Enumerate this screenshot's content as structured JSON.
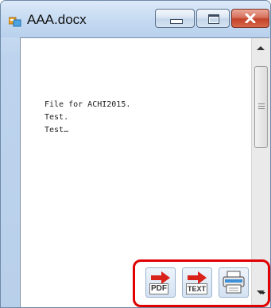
{
  "window": {
    "title": "AAA.docx",
    "title_icon": "app-window-icon",
    "controls": {
      "minimize": "minimize-icon",
      "maximize": "maximize-icon",
      "close": "close-icon"
    }
  },
  "document": {
    "lines": [
      "File for ACHI2015.",
      "Test.",
      "Test…"
    ]
  },
  "toolbar": {
    "highlight_color": "#e00000",
    "buttons": [
      {
        "name": "export-pdf-button",
        "label": "PDF",
        "icon": "export-pdf-icon"
      },
      {
        "name": "export-text-button",
        "label": "TEXT",
        "icon": "export-text-icon"
      },
      {
        "name": "print-button",
        "label": "",
        "icon": "printer-icon"
      }
    ],
    "overflow_icon": "toolbar-overflow-icon"
  }
}
